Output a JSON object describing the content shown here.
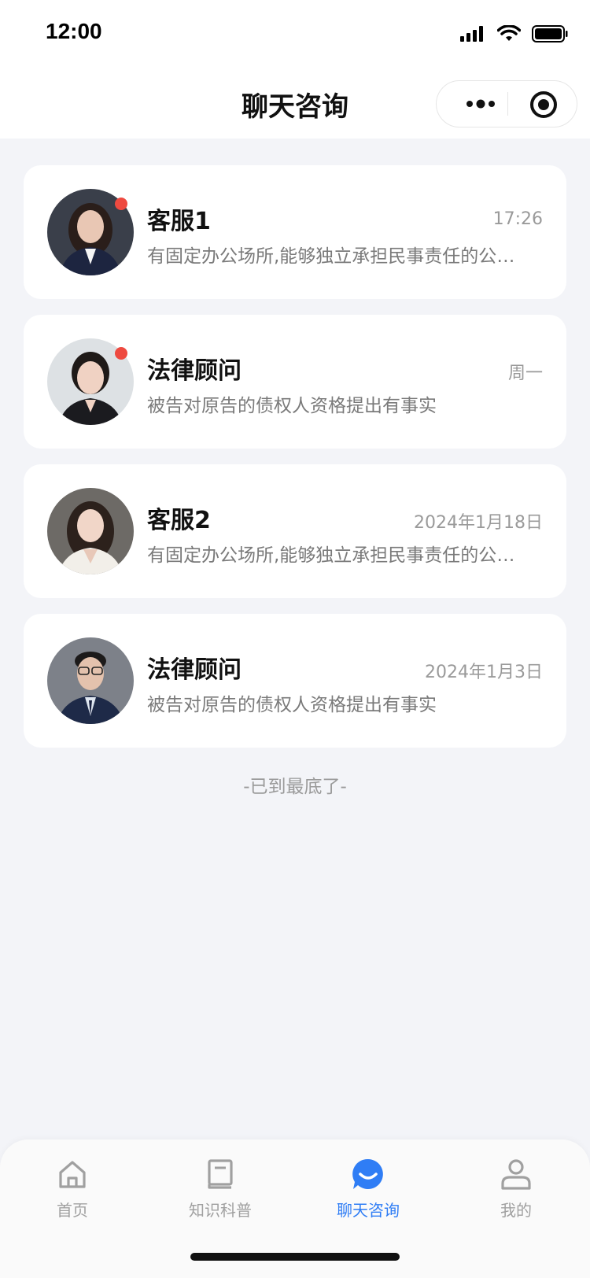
{
  "status_bar": {
    "time": "12:00"
  },
  "header": {
    "title": "聊天咨询"
  },
  "conversations": [
    {
      "name": "客服1",
      "time": "17:26",
      "preview": "有固定办公场所,能够独立承担民事责任的公司律师事务所",
      "unread": true,
      "avatar": "avatar-woman-1"
    },
    {
      "name": "法律顾问",
      "time": "周一",
      "preview": "被告对原告的债权人资格提出有事实",
      "unread": true,
      "avatar": "avatar-woman-2"
    },
    {
      "name": "客服2",
      "time": "2024年1月18日",
      "preview": "有固定办公场所,能够独立承担民事责任的公司律师事务所",
      "unread": false,
      "avatar": "avatar-woman-3"
    },
    {
      "name": "法律顾问",
      "time": "2024年1月3日",
      "preview": "被告对原告的债权人资格提出有事实",
      "unread": false,
      "avatar": "avatar-man-1"
    }
  ],
  "list_end_text": "-已到最底了-",
  "tabbar": [
    {
      "label": "首页",
      "icon": "home-icon",
      "active": false
    },
    {
      "label": "知识科普",
      "icon": "book-icon",
      "active": false
    },
    {
      "label": "聊天咨询",
      "icon": "chat-icon",
      "active": true
    },
    {
      "label": "我的",
      "icon": "user-icon",
      "active": false
    }
  ],
  "colors": {
    "accent": "#2f7df5",
    "unread_dot": "#ee4a40",
    "background": "#f3f4f8"
  }
}
